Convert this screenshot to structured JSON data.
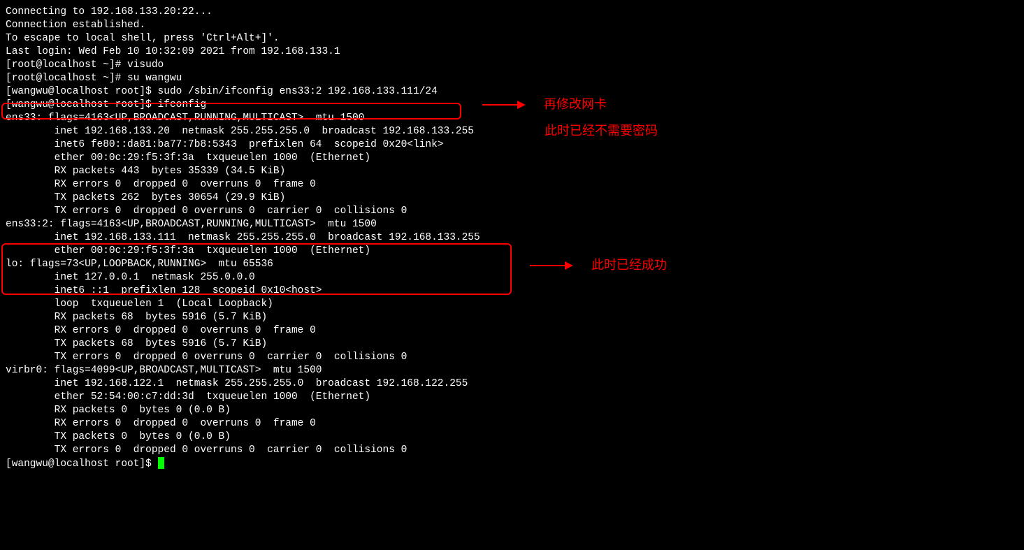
{
  "terminal": {
    "lines": [
      "Connecting to 192.168.133.20:22...",
      "Connection established.",
      "To escape to local shell, press 'Ctrl+Alt+]'.",
      "",
      "Last login: Wed Feb 10 10:32:09 2021 from 192.168.133.1",
      "[root@localhost ~]# visudo",
      "[root@localhost ~]# su wangwu",
      "[wangwu@localhost root]$ sudo /sbin/ifconfig ens33:2 192.168.133.111/24",
      "[wangwu@localhost root]$ ifconfig",
      "ens33: flags=4163<UP,BROADCAST,RUNNING,MULTICAST>  mtu 1500",
      "        inet 192.168.133.20  netmask 255.255.255.0  broadcast 192.168.133.255",
      "        inet6 fe80::da81:ba77:7b8:5343  prefixlen 64  scopeid 0x20<link>",
      "        ether 00:0c:29:f5:3f:3a  txqueuelen 1000  (Ethernet)",
      "        RX packets 443  bytes 35339 (34.5 KiB)",
      "        RX errors 0  dropped 0  overruns 0  frame 0",
      "        TX packets 262  bytes 30654 (29.9 KiB)",
      "        TX errors 0  dropped 0 overruns 0  carrier 0  collisions 0",
      "",
      "ens33:2: flags=4163<UP,BROADCAST,RUNNING,MULTICAST>  mtu 1500",
      "        inet 192.168.133.111  netmask 255.255.255.0  broadcast 192.168.133.255",
      "        ether 00:0c:29:f5:3f:3a  txqueuelen 1000  (Ethernet)",
      "",
      "lo: flags=73<UP,LOOPBACK,RUNNING>  mtu 65536",
      "        inet 127.0.0.1  netmask 255.0.0.0",
      "        inet6 ::1  prefixlen 128  scopeid 0x10<host>",
      "        loop  txqueuelen 1  (Local Loopback)",
      "        RX packets 68  bytes 5916 (5.7 KiB)",
      "        RX errors 0  dropped 0  overruns 0  frame 0",
      "        TX packets 68  bytes 5916 (5.7 KiB)",
      "        TX errors 0  dropped 0 overruns 0  carrier 0  collisions 0",
      "",
      "virbr0: flags=4099<UP,BROADCAST,MULTICAST>  mtu 1500",
      "        inet 192.168.122.1  netmask 255.255.255.0  broadcast 192.168.122.255",
      "        ether 52:54:00:c7:dd:3d  txqueuelen 1000  (Ethernet)",
      "        RX packets 0  bytes 0 (0.0 B)",
      "        RX errors 0  dropped 0  overruns 0  frame 0",
      "        TX packets 0  bytes 0 (0.0 B)",
      "        TX errors 0  dropped 0 overruns 0  carrier 0  collisions 0",
      "",
      "[wangwu@localhost root]$ "
    ]
  },
  "annotations": {
    "a1": "再修改网卡",
    "a2": "此时已经不需要密码",
    "a3": "此时已经成功"
  }
}
